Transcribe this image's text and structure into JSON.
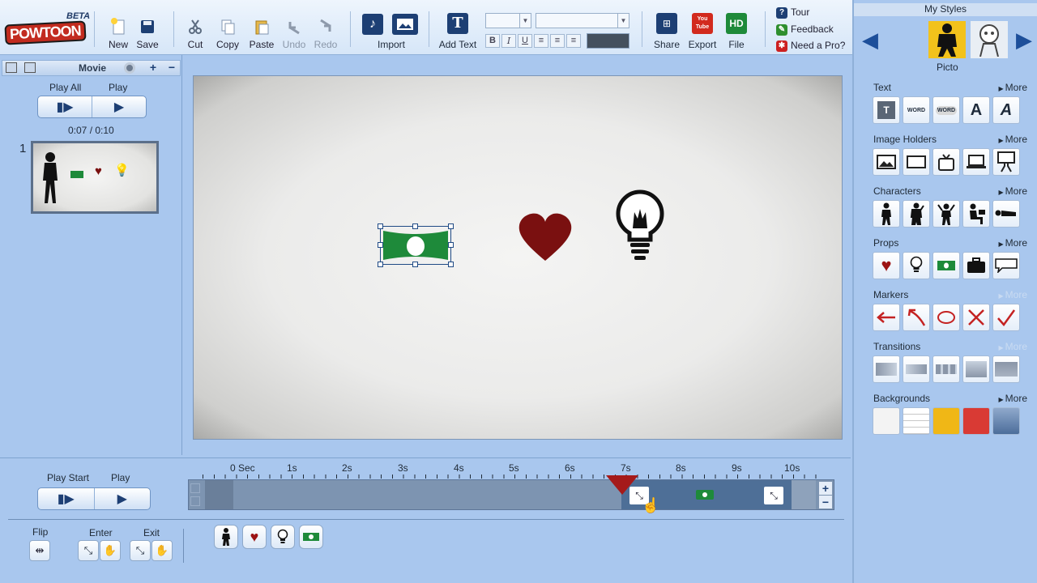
{
  "app": {
    "logo_text": "POWTOON",
    "beta_label": "BETA"
  },
  "toolbar": {
    "new_label": "New",
    "save_label": "Save",
    "cut_label": "Cut",
    "copy_label": "Copy",
    "paste_label": "Paste",
    "undo_label": "Undo",
    "redo_label": "Redo",
    "import_label": "Import",
    "add_text_label": "Add Text",
    "bold_label": "B",
    "italic_label": "I",
    "underline_label": "U",
    "share_label": "Share",
    "export_label": "Export",
    "file_label": "File",
    "file_icon_text": "HD",
    "export_icon_text": "You Tube"
  },
  "help": {
    "tour_label": "Tour",
    "feedback_label": "Feedback",
    "pro_label": "Need a Pro?"
  },
  "left_panel": {
    "movie_label": "Movie",
    "play_all_label": "Play All",
    "play_label": "Play",
    "time_display": "0:07 / 0:10",
    "slide_number": "1"
  },
  "right_panel": {
    "my_styles_label": "My Styles",
    "style_name": "Picto",
    "more_label": "More",
    "sections": {
      "text": "Text",
      "image_holders": "Image Holders",
      "characters": "Characters",
      "props": "Props",
      "markers": "Markers",
      "transitions": "Transitions",
      "backgrounds": "Backgrounds"
    },
    "text_tile_word": "WORD",
    "text_tile_letter": "A",
    "text_tile_t": "T"
  },
  "timeline": {
    "play_start_label": "Play Start",
    "play_label": "Play",
    "ticks": [
      "0 Sec",
      "1s",
      "2s",
      "3s",
      "4s",
      "5s",
      "6s",
      "7s",
      "8s",
      "9s",
      "10s"
    ],
    "playhead_seconds": 7.0,
    "selected_item_range_seconds": [
      7.0,
      10.0
    ],
    "flip_label": "Flip",
    "enter_label": "Enter",
    "exit_label": "Exit"
  },
  "colors": {
    "accent_blue": "#1e4f9a",
    "money_green": "#1e8a3a",
    "heart_red": "#7a1010",
    "timeline_dark": "#4e6f97"
  }
}
